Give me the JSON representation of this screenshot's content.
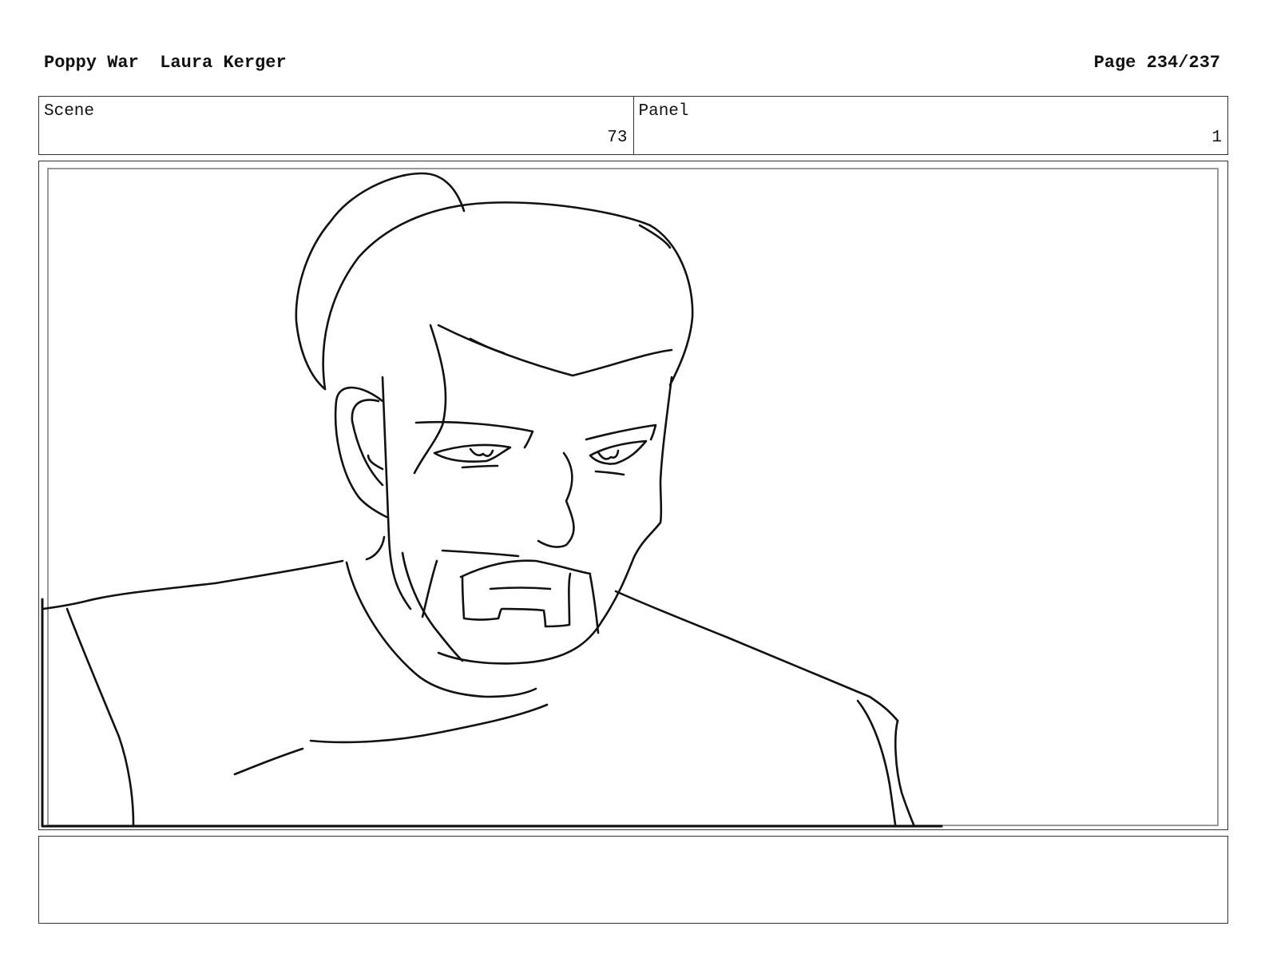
{
  "header": {
    "project_title": "Poppy War",
    "author": "Laura Kerger",
    "page_label": "Page 234/237"
  },
  "scene": {
    "label": "Scene",
    "value": "73"
  },
  "panel": {
    "label": "Panel",
    "value": "1"
  },
  "frame": {
    "drawing": "storyboard-sketch-man-portrait"
  },
  "notes": {
    "text": ""
  }
}
